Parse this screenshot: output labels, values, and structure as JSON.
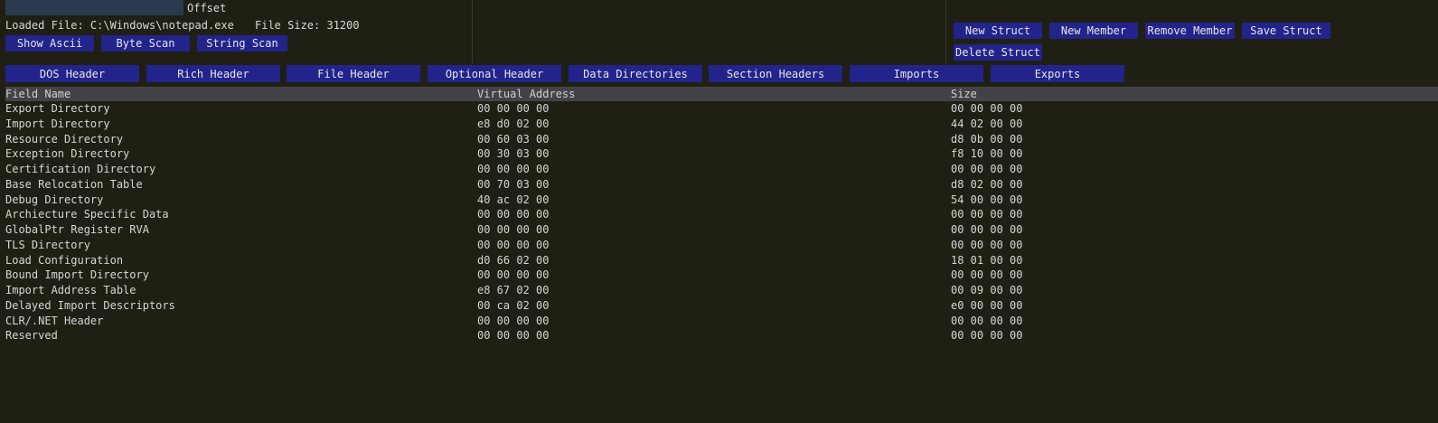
{
  "offset": {
    "label": "Offset",
    "value": ""
  },
  "file_info": {
    "loaded_file": "Loaded File: C:\\Windows\\notepad.exe",
    "file_size": "File Size: 31200"
  },
  "scan_buttons": [
    "Show Ascii",
    "Byte Scan",
    "String Scan"
  ],
  "struct_buttons": [
    "New Struct",
    "New Member",
    "Remove Member",
    "Save Struct",
    "Delete Struct"
  ],
  "tabs": [
    "DOS Header",
    "Rich Header",
    "File Header",
    "Optional Header",
    "Data Directories",
    "Section Headers",
    "Imports",
    "Exports"
  ],
  "table": {
    "columns": [
      "Field Name",
      "Virtual Address",
      "Size"
    ],
    "rows": [
      [
        "Export Directory",
        "00 00 00 00",
        "00 00 00 00"
      ],
      [
        "Import Directory",
        "e8 d0 02 00",
        "44 02 00 00"
      ],
      [
        "Resource Directory",
        "00 60 03 00",
        "d8 0b 00 00"
      ],
      [
        "Exception Directory",
        "00 30 03 00",
        "f8 10 00 00"
      ],
      [
        "Certification Directory",
        "00 00 00 00",
        "00 00 00 00"
      ],
      [
        "Base Relocation Table",
        "00 70 03 00",
        "d8 02 00 00"
      ],
      [
        "Debug Directory",
        "40 ac 02 00",
        "54 00 00 00"
      ],
      [
        "Archiecture Specific Data",
        "00 00 00 00",
        "00 00 00 00"
      ],
      [
        "GlobalPtr Register RVA",
        "00 00 00 00",
        "00 00 00 00"
      ],
      [
        "TLS Directory",
        "00 00 00 00",
        "00 00 00 00"
      ],
      [
        "Load Configuration",
        "d0 66 02 00",
        "18 01 00 00"
      ],
      [
        "Bound Import Directory",
        "00 00 00 00",
        "00 00 00 00"
      ],
      [
        "Import Address Table",
        "e8 67 02 00",
        "00 09 00 00"
      ],
      [
        "Delayed Import Descriptors",
        "00 ca 02 00",
        "e0 00 00 00"
      ],
      [
        "CLR/.NET Header",
        "00 00 00 00",
        "00 00 00 00"
      ],
      [
        "Reserved",
        "00 00 00 00",
        "00 00 00 00"
      ]
    ]
  },
  "colors": {
    "background": "#1f1f14",
    "button": "#23238c",
    "table_header": "#434347",
    "input": "#2b3a4e"
  }
}
